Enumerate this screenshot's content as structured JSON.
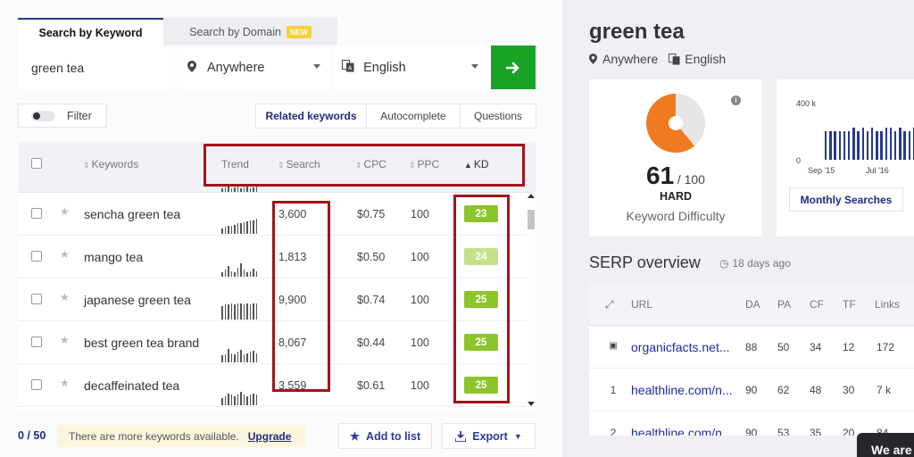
{
  "tabs": {
    "active": "Search by Keyword",
    "inactive": "Search by Domain",
    "new_badge": "NEW"
  },
  "search": {
    "keyword": "green tea",
    "location": "Anywhere",
    "language": "English"
  },
  "filter_label": "Filter",
  "subtabs": [
    "Related keywords",
    "Autocomplete",
    "Questions"
  ],
  "table": {
    "headers": {
      "keywords": "Keywords",
      "trend": "Trend",
      "search": "Search",
      "cpc": "CPC",
      "ppc": "PPC",
      "kd": "KD"
    },
    "rows": [
      {
        "keyword": "sencha green tea",
        "search": "3,600",
        "cpc": "$0.75",
        "ppc": "100",
        "kd": "23",
        "trend": [
          5,
          6,
          7,
          7,
          8,
          9,
          9,
          10,
          11,
          12,
          12,
          13
        ]
      },
      {
        "keyword": "mango tea",
        "search": "1,813",
        "cpc": "$0.50",
        "ppc": "100",
        "kd": "24",
        "trend": [
          4,
          6,
          9,
          5,
          4,
          8,
          12,
          6,
          4,
          5,
          7,
          5
        ]
      },
      {
        "keyword": "japanese green tea",
        "search": "9,900",
        "cpc": "$0.74",
        "ppc": "100",
        "kd": "25",
        "trend": [
          12,
          13,
          13,
          14,
          13,
          14,
          14,
          13,
          14,
          13,
          14,
          14
        ]
      },
      {
        "keyword": "best green tea brand",
        "search": "8,067",
        "cpc": "$0.44",
        "ppc": "100",
        "kd": "25",
        "trend": [
          6,
          7,
          12,
          8,
          7,
          9,
          11,
          7,
          8,
          9,
          10,
          8
        ]
      },
      {
        "keyword": "decaffeinated tea",
        "search": "3,559",
        "cpc": "$0.61",
        "ppc": "100",
        "kd": "25",
        "trend": [
          6,
          8,
          10,
          9,
          8,
          9,
          12,
          9,
          8,
          9,
          10,
          9
        ]
      }
    ]
  },
  "footer": {
    "count": "0 / 50",
    "more_text": "There are more keywords available.",
    "upgrade": "Upgrade",
    "add_to_list": "Add to list",
    "export": "Export"
  },
  "overview": {
    "keyword": "green tea",
    "location": "Anywhere",
    "language": "English",
    "difficulty": {
      "value": "61",
      "denominator": "/ 100",
      "rating": "HARD",
      "label": "Keyword Difficulty",
      "fraction": 0.61
    },
    "volume_chart": {
      "y_top": "400 k",
      "y_zero": "0",
      "x_labels": [
        "Sep '15",
        "Jul '16"
      ],
      "button": "Monthly Searches",
      "bars": [
        0.54,
        0.54,
        0.54,
        0.54,
        0.54,
        0.54,
        0.6,
        0.54,
        0.6,
        0.54,
        0.6,
        0.54,
        0.54,
        0.6,
        0.6,
        0.54,
        0.6,
        0.54,
        0.54,
        0.6,
        0.54,
        0.54,
        0.6,
        0.54,
        0.54,
        0.6,
        0.6,
        0.9
      ]
    }
  },
  "serp": {
    "title": "SERP overview",
    "time": "18 days ago",
    "headers": {
      "url": "URL",
      "da": "DA",
      "pa": "PA",
      "cf": "CF",
      "tf": "TF",
      "links": "Links"
    },
    "rows": [
      {
        "rank": "",
        "url": "organicfacts.net...",
        "da": "88",
        "pa": "50",
        "cf": "34",
        "tf": "12",
        "links": "172"
      },
      {
        "rank": "1",
        "url": "healthline.com/n...",
        "da": "90",
        "pa": "62",
        "cf": "48",
        "tf": "30",
        "links": "7 k"
      },
      {
        "rank": "2",
        "url": "healthline.com/n...",
        "da": "90",
        "pa": "53",
        "cf": "35",
        "tf": "20",
        "links": "84"
      }
    ]
  },
  "chat_text": "We are",
  "colors": {
    "accent_green": "#18a325",
    "kd_green": "#8cc52a",
    "kd_light": "#c4e08a",
    "donut_orange": "#ef7a1f",
    "bar_blue": "#273a8e",
    "highlight": "#a0141c"
  }
}
